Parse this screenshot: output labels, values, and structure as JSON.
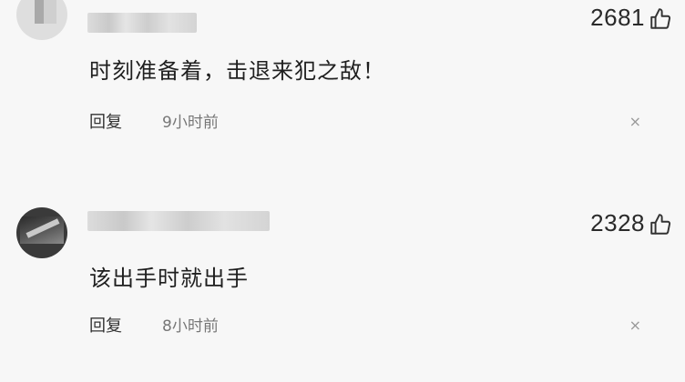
{
  "comments": [
    {
      "likes": "2681",
      "text": "时刻准备着，击退来犯之敌！",
      "reply_label": "回复",
      "time": "9小时前",
      "close": "×"
    },
    {
      "likes": "2328",
      "text": "该出手时就出手",
      "reply_label": "回复",
      "time": "8小时前",
      "close": "×"
    }
  ],
  "icons": {
    "like": "thumbs-up-icon",
    "dismiss": "close-icon"
  }
}
